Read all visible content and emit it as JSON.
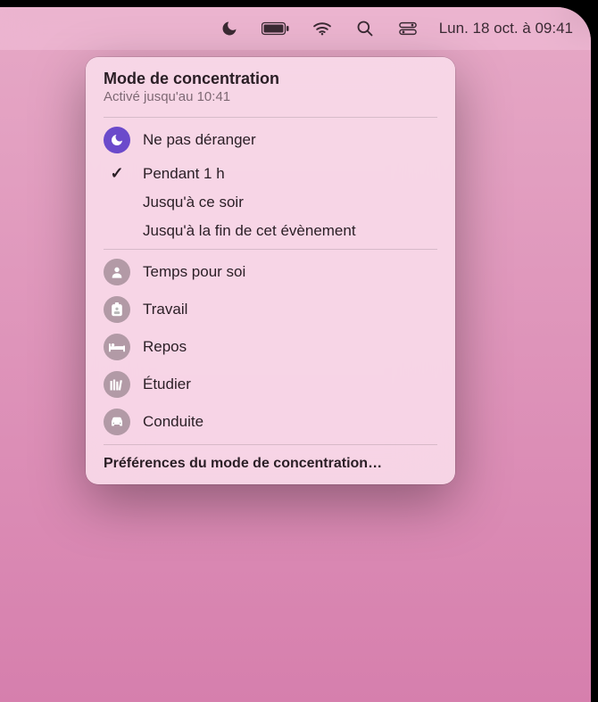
{
  "menubar": {
    "datetime": "Lun. 18 oct. à  09:41"
  },
  "dropdown": {
    "title": "Mode de concentration",
    "subtitle": "Activé jusqu'au 10:41",
    "dnd_label": "Ne pas déranger",
    "durations": [
      "Pendant 1 h",
      "Jusqu'à ce soir",
      "Jusqu'à la fin de cet évènement"
    ],
    "modes": [
      {
        "label": "Temps pour soi"
      },
      {
        "label": "Travail"
      },
      {
        "label": "Repos"
      },
      {
        "label": "Étudier"
      },
      {
        "label": "Conduite"
      }
    ],
    "prefs_label": "Préférences du mode de concentration…"
  }
}
